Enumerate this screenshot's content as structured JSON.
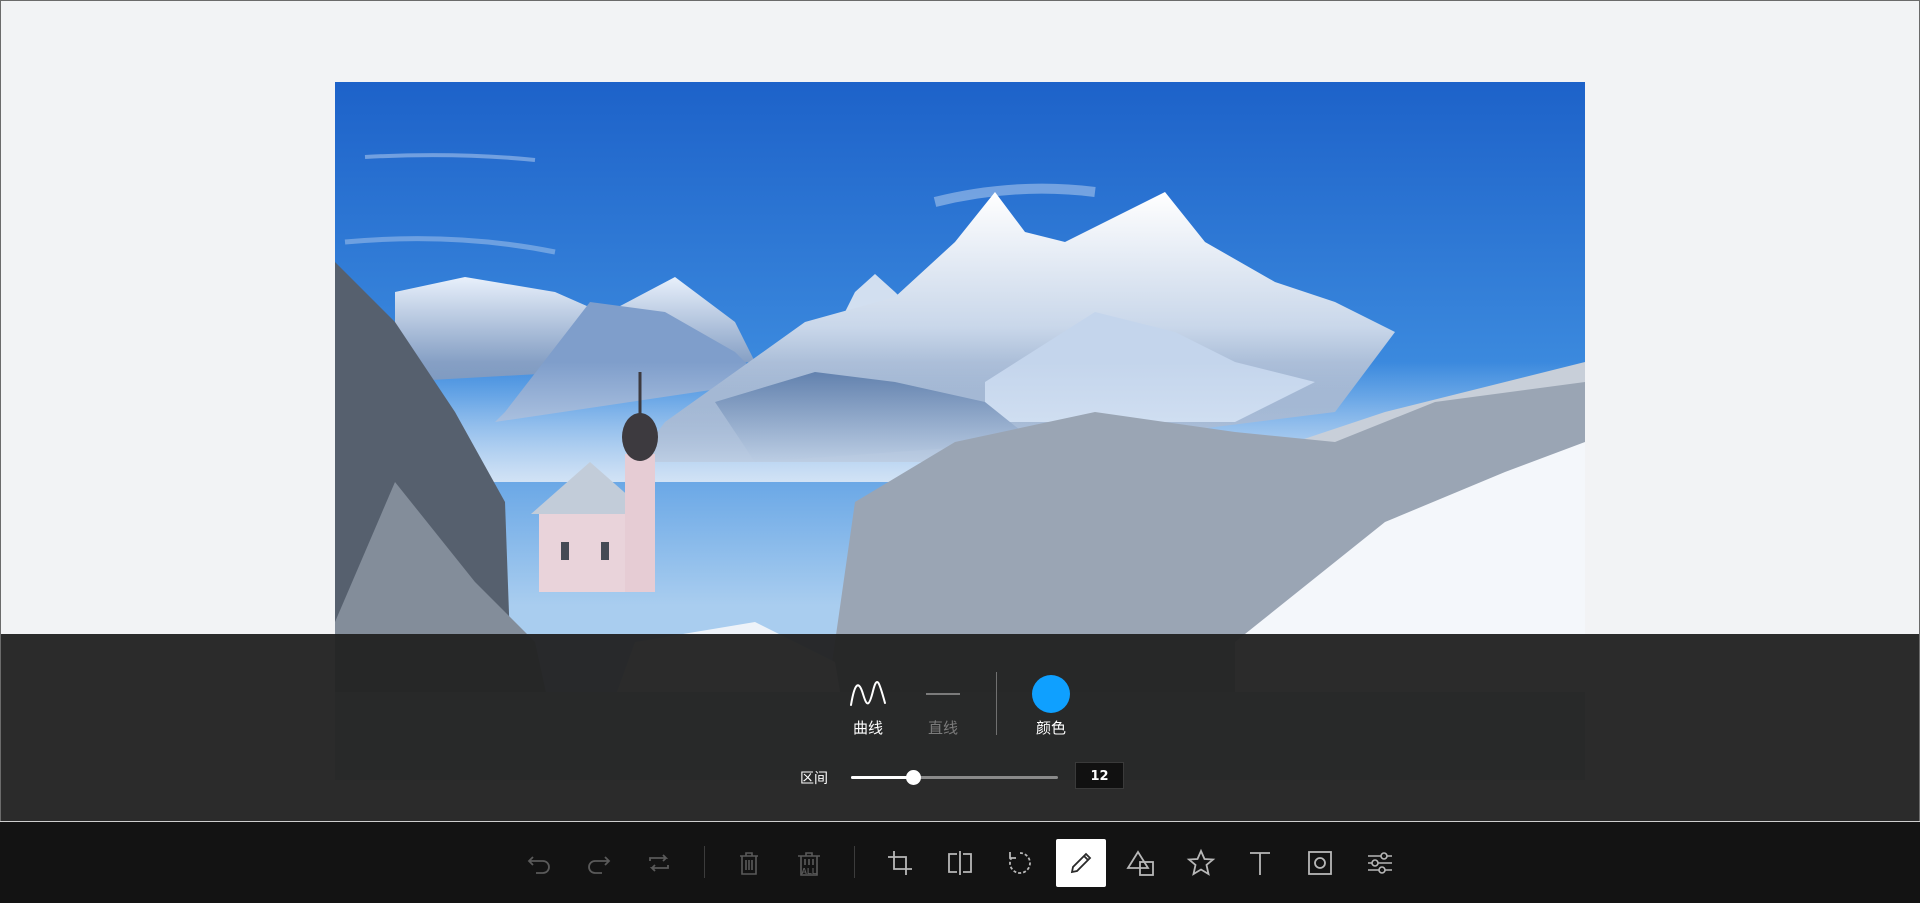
{
  "photo": {
    "subject": "snowy alpine landscape with church"
  },
  "draw_panel": {
    "brush_types": [
      {
        "label": "曲线",
        "icon": "curve-icon",
        "selected": true
      },
      {
        "label": "直线",
        "icon": "straight-line-icon",
        "selected": false
      }
    ],
    "color": {
      "label": "颜色",
      "value": "#0fa0ff"
    },
    "range": {
      "label": "区间",
      "value": "12",
      "fraction": 0.3
    }
  },
  "toolbar": {
    "tools": [
      {
        "name": "undo-icon",
        "enabled": false
      },
      {
        "name": "redo-icon",
        "enabled": false
      },
      {
        "name": "reset-icon",
        "enabled": false
      },
      {
        "name": "delete-icon",
        "enabled": false
      },
      {
        "name": "delete-all-icon",
        "enabled": false,
        "text": "ALL"
      },
      {
        "name": "crop-icon",
        "enabled": true
      },
      {
        "name": "flip-icon",
        "enabled": true
      },
      {
        "name": "rotate-icon",
        "enabled": true
      },
      {
        "name": "draw-icon",
        "enabled": true,
        "active": true
      },
      {
        "name": "shape-icon",
        "enabled": true
      },
      {
        "name": "icon-tool-icon",
        "enabled": true
      },
      {
        "name": "text-icon",
        "enabled": true
      },
      {
        "name": "mask-icon",
        "enabled": true
      },
      {
        "name": "filter-icon",
        "enabled": true
      }
    ]
  }
}
